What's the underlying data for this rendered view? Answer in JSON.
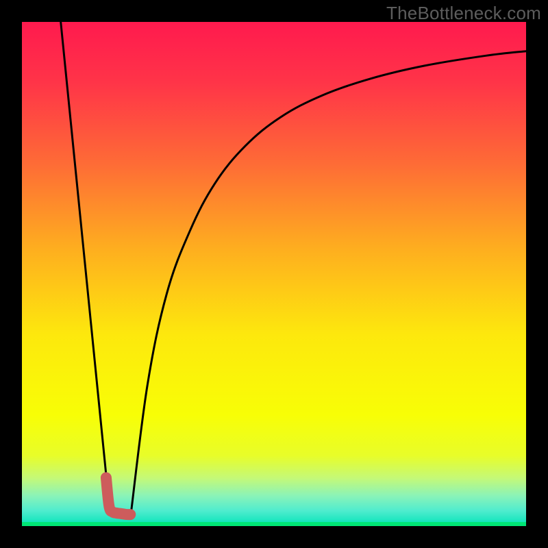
{
  "watermark": "TheBottleneck.com",
  "chart_data": {
    "type": "line",
    "title": "",
    "xlabel": "",
    "ylabel": "",
    "xlim": [
      0,
      100
    ],
    "ylim": [
      0,
      100
    ],
    "grid": false,
    "legend": false,
    "note": "Values are read approximately from pixel positions; y is percent from bottom (0) to top (100).",
    "series": [
      {
        "name": "left-descending-line",
        "x": [
          7.7,
          17.2
        ],
        "y": [
          100,
          5.2
        ]
      },
      {
        "name": "right-curve",
        "x": [
          21.6,
          24.9,
          28.7,
          33.3,
          38.3,
          44.3,
          51.3,
          59.5,
          69.0,
          79.8,
          92.0,
          100.0
        ],
        "y": [
          2.3,
          28.0,
          46.0,
          58.5,
          68.0,
          75.4,
          81.1,
          85.4,
          88.7,
          91.3,
          93.3,
          94.2
        ]
      },
      {
        "name": "marker-stroke",
        "x": [
          16.7,
          17.3,
          18.0,
          18.7,
          19.4,
          20.1,
          20.8,
          21.5
        ],
        "y": [
          9.6,
          3.9,
          2.8,
          2.6,
          2.5,
          2.4,
          2.3,
          2.3
        ]
      }
    ],
    "background_gradient": {
      "stops": [
        {
          "pos": 0.0,
          "color": "#ff1a4e"
        },
        {
          "pos": 0.12,
          "color": "#ff3448"
        },
        {
          "pos": 0.28,
          "color": "#fe6b36"
        },
        {
          "pos": 0.45,
          "color": "#feae1f"
        },
        {
          "pos": 0.62,
          "color": "#fde80d"
        },
        {
          "pos": 0.78,
          "color": "#f8fe06"
        },
        {
          "pos": 0.86,
          "color": "#e8fd29"
        },
        {
          "pos": 0.905,
          "color": "#c4f978"
        },
        {
          "pos": 0.94,
          "color": "#8af3b8"
        },
        {
          "pos": 0.97,
          "color": "#4eecce"
        },
        {
          "pos": 1.0,
          "color": "#00e3b7"
        }
      ]
    },
    "green_band": {
      "y0": 0.0,
      "y1": 0.8
    },
    "marker_color": "#cd5c5c",
    "curve_color": "#000000"
  }
}
